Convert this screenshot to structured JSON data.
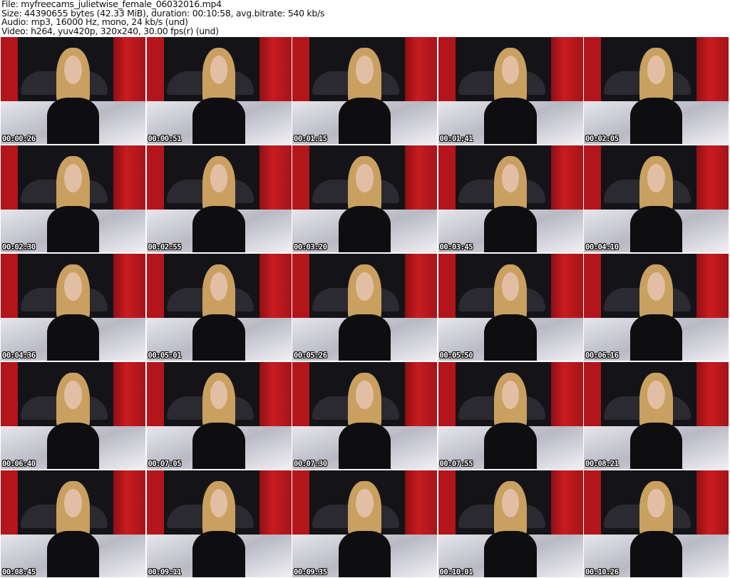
{
  "header": {
    "file": "File: myfreecams_julietwise_female_06032016.mp4",
    "size": "Size: 44390655 bytes (42.33 MiB), duration: 00:10:58, avg.bitrate: 540 kb/s",
    "audio": "Audio: mp3, 16000 Hz, mono, 24 kb/s (und)",
    "video": "Video: h264, yuv420p, 320x240, 30.00 fps(r) (und)"
  },
  "thumbnails": [
    "00:00:26",
    "00:00:51",
    "00:01:15",
    "00:01:41",
    "00:02:05",
    "00:02:30",
    "00:02:55",
    "00:03:20",
    "00:03:45",
    "00:04:10",
    "00:04:36",
    "00:05:01",
    "00:05:26",
    "00:05:50",
    "00:06:16",
    "00:06:40",
    "00:07:05",
    "00:07:30",
    "00:07:55",
    "00:08:21",
    "00:08:45",
    "00:09:11",
    "00:09:35",
    "00:10:01",
    "00:10:26"
  ]
}
